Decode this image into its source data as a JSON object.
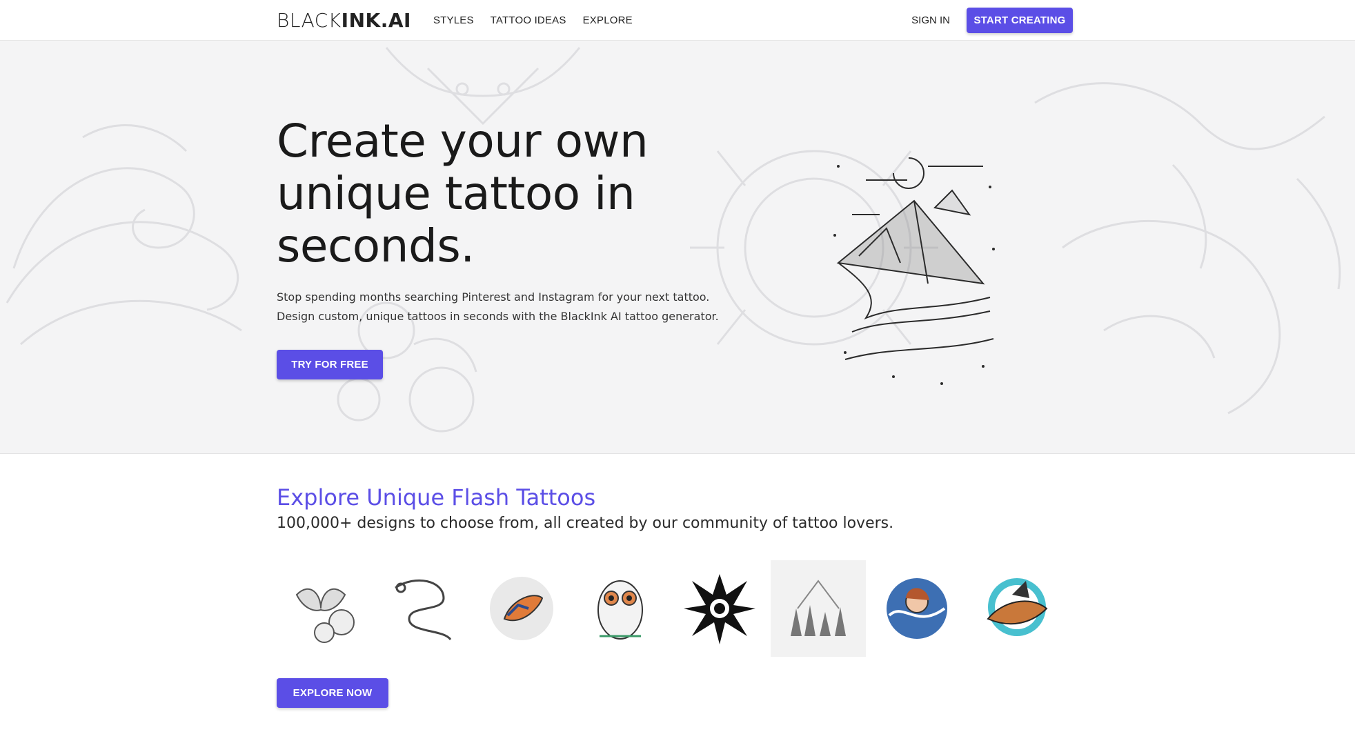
{
  "nav": {
    "logo_light": "BLACK",
    "logo_bold": "INK.AI",
    "links": [
      "STYLES",
      "TATTOO IDEAS",
      "EXPLORE"
    ],
    "signin": "SIGN IN",
    "cta": "START CREATING"
  },
  "hero": {
    "title": "Create your own unique tattoo in seconds.",
    "text_line1": "Stop spending months searching Pinterest and Instagram for your next tattoo.",
    "text_line2": "Design custom, unique tattoos in seconds with the BlackInk AI tattoo generator.",
    "button": "TRY FOR FREE"
  },
  "explore": {
    "title": "Explore Unique Flash Tattoos",
    "subtitle": "100,000+ designs to choose from, all created by our community of tattoo lovers.",
    "thumbnails": [
      "butterfly-roses",
      "dragon",
      "koi-fish",
      "owl",
      "eagle",
      "forest-mountains",
      "woman-waves",
      "bird-circle"
    ],
    "button": "EXPLORE NOW"
  },
  "colors": {
    "accent": "#5b4ee6",
    "hero_bg": "#f4f4f5"
  }
}
